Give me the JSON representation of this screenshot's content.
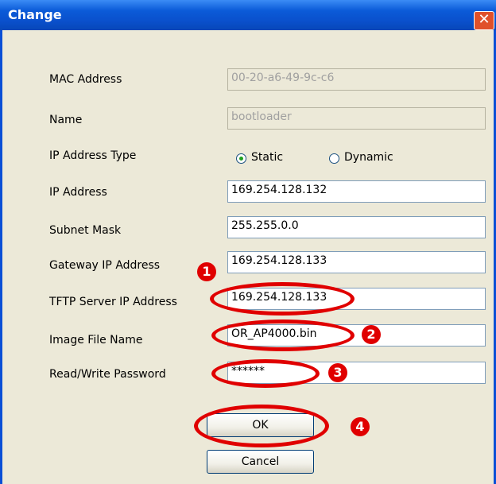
{
  "window": {
    "title": "Change",
    "close_glyph": "✕"
  },
  "form": {
    "mac_label": "MAC Address",
    "mac_value": "00-20-a6-49-9c-c6",
    "name_label": "Name",
    "name_value": "bootloader",
    "ip_type_label": "IP Address Type",
    "ip_type_options": [
      "Static",
      "Dynamic"
    ],
    "ip_type_selected": "Static",
    "ip_label": "IP Address",
    "ip_value": "169.254.128.132",
    "subnet_label": "Subnet Mask",
    "subnet_value": "255.255.0.0",
    "gateway_label": "Gateway IP Address",
    "gateway_value": "169.254.128.133",
    "tftp_label": "TFTP Server IP Address",
    "tftp_value": "169.254.128.133",
    "image_label": "Image File Name",
    "image_value": "OR_AP4000.bin",
    "password_label": "Read/Write Password",
    "password_value": "******"
  },
  "buttons": {
    "ok": "OK",
    "cancel": "Cancel"
  },
  "annotations": {
    "n1": "1",
    "n2": "2",
    "n3": "3",
    "n4": "4",
    "color": "#e00000"
  }
}
